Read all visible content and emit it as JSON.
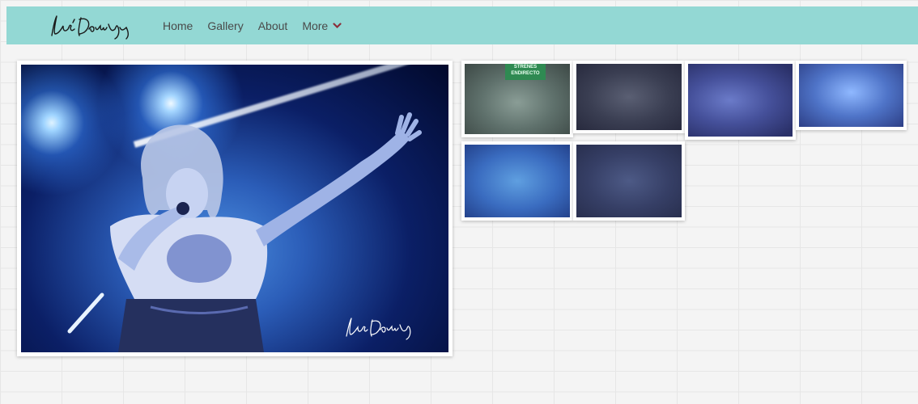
{
  "nav": {
    "items": [
      {
        "label": "Home"
      },
      {
        "label": "Gallery"
      },
      {
        "label": "About"
      },
      {
        "label": "More"
      }
    ]
  },
  "thumbnails": [
    {
      "sign": "STRENES\nENDIRECTO"
    },
    {},
    {},
    {},
    {},
    {}
  ],
  "colors": {
    "navbar": "#93d8d4",
    "nav_text": "#4a4a4a",
    "chevron": "#8b2f3a"
  },
  "icons": {
    "more_dropdown": "chevron-down-icon"
  }
}
